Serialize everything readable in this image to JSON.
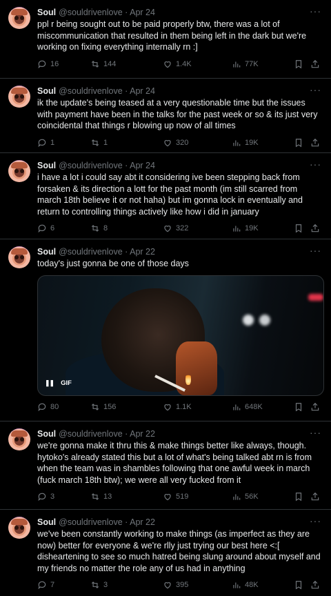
{
  "tweets": [
    {
      "name": "Soul",
      "meta": "@souldrivenlove · Apr 24",
      "text": "ppl r being sought out to be paid properly btw, there was a lot of miscommunication that resulted in them being left in the dark but we're working on fixing everything internally rn :]",
      "replies": "16",
      "retweets": "144",
      "likes": "1.4K",
      "views": "77K"
    },
    {
      "name": "Soul",
      "meta": "@souldrivenlove · Apr 24",
      "text": "ik the update's being teased at a very questionable time but the issues with payment have been in the talks for the past week or so & its just very coincidental that things r blowing up now of all times",
      "replies": "1",
      "retweets": "1",
      "likes": "320",
      "views": "19K"
    },
    {
      "name": "Soul",
      "meta": "@souldrivenlove · Apr 24",
      "text": "i have a lot i could say abt it considering ive been stepping back from forsaken & its direction a lott for the past month (im still scarred from march 18th believe it or not haha) but im gonna lock in eventually and return to controlling things actively like how i did in january",
      "replies": "6",
      "retweets": "8",
      "likes": "322",
      "views": "19K"
    },
    {
      "name": "Soul",
      "meta": "@souldrivenlove · Apr 22",
      "text": "today's just gonna be one of those days",
      "gif_label": "GIF",
      "replies": "80",
      "retweets": "156",
      "likes": "1.1K",
      "views": "648K"
    },
    {
      "name": "Soul",
      "meta": "@souldrivenlove · Apr 22",
      "text": "we're gonna make it thru this & make things better like always, though. hytoko's already stated this but a lot of what's being talked abt rn is from when the team was in shambles following that one awful week in march (fuck march 18th btw); we were all very fucked from it",
      "replies": "3",
      "retweets": "13",
      "likes": "519",
      "views": "56K"
    },
    {
      "name": "Soul",
      "meta": "@souldrivenlove · Apr 22",
      "text": "we've been constantly working to make things (as imperfect as they are now) better for everyone & we're rlly just trying our best here <:[ disheartening to see so much hatred being slung around about myself and my friends no matter the role any of us had in anything",
      "replies": "7",
      "retweets": "3",
      "likes": "395",
      "views": "48K"
    }
  ],
  "icons": [
    "more-icon",
    "reply-icon",
    "retweet-icon",
    "like-icon",
    "views-icon",
    "bookmark-icon",
    "share-icon",
    "pause-icon"
  ],
  "colors": {
    "background": "#000000",
    "text": "#e7e9ea",
    "muted": "#71767b",
    "border": "#2f3336"
  }
}
